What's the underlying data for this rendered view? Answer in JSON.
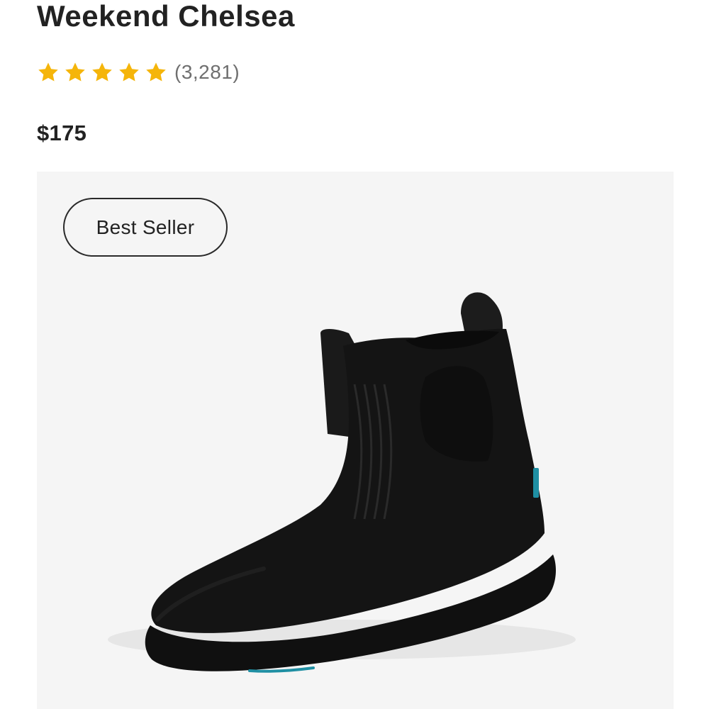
{
  "product": {
    "title": "Weekend Chelsea",
    "rating": 5,
    "rating_max": 5,
    "review_count": "(3,281)",
    "price": "$175",
    "badge": "Best Seller"
  },
  "icons": {
    "star": "star-icon"
  },
  "colors": {
    "star": "#f5b50a",
    "hero_bg": "#f5f5f5",
    "boot": "#141414",
    "accent_tab": "#1f8fa3"
  }
}
